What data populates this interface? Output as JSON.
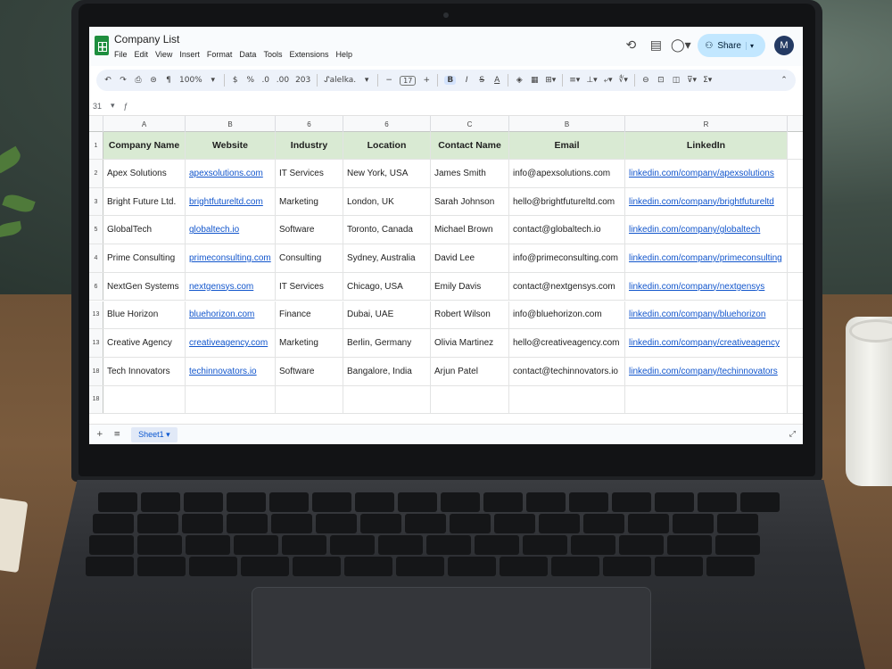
{
  "app": {
    "title": "Company List",
    "menu": [
      "File",
      "Edit",
      "View",
      "Insert",
      "Format",
      "Data",
      "Tools",
      "Extensions",
      "Help"
    ],
    "share_label": "Share",
    "avatar_initial": "M"
  },
  "toolbar": {
    "zoom": "100%",
    "currency": "$",
    "percent": "%",
    "decimals_dec": ".0",
    "decimals_inc": ".00",
    "format_123": "203",
    "font": "ᔑalelka.",
    "font_size": "17",
    "bold": "B",
    "italic": "I",
    "strike": "S",
    "text_color": "A"
  },
  "formula_bar": {
    "cell_ref": "31",
    "fx": "ƒ"
  },
  "columns": [
    "A",
    "B",
    "6",
    "6",
    "C",
    "B",
    "R"
  ],
  "header_row_number": "1",
  "headers": [
    "Company Name",
    "Website",
    "Industry",
    "Location",
    "Contact Name",
    "Email",
    "LinkedIn"
  ],
  "rows": [
    {
      "num": "2",
      "company": "Apex Solutions",
      "website": "apexsolutions.com",
      "industry": "IT Services",
      "location": "New York, USA",
      "contact": "James Smith",
      "email": "info@apexsolutions.com",
      "linkedin": "linkedin.com/company/apexsolutions"
    },
    {
      "num": "3",
      "company": "Bright Future Ltd.",
      "website": "brightfutureltd.com",
      "industry": "Marketing",
      "location": "London, UK",
      "contact": "Sarah Johnson",
      "email": "hello@brightfutureltd.com",
      "linkedin": "linkedin.com/company/brightfutureltd"
    },
    {
      "num": "5",
      "company": "GlobalTech",
      "website": "globaltech.io",
      "industry": "Software",
      "location": "Toronto, Canada",
      "contact": "Michael Brown",
      "email": "contact@globaltech.io",
      "linkedin": "linkedin.com/company/globaltech"
    },
    {
      "num": "4",
      "company": "Prime Consulting",
      "website": "primeconsulting.com",
      "industry": "Consulting",
      "location": "Sydney, Australia",
      "contact": "David Lee",
      "email": "info@primeconsulting.com",
      "linkedin": "linkedin.com/company/primeconsulting"
    },
    {
      "num": "6",
      "company": "NextGen Systems",
      "website": "nextgensys.com",
      "industry": "IT Services",
      "location": "Chicago, USA",
      "contact": "Emily Davis",
      "email": "contact@nextgensys.com",
      "linkedin": "linkedin.com/company/nextgensys"
    },
    {
      "num": "13",
      "company": "Blue Horizon",
      "website": "bluehorizon.com",
      "industry": "Finance",
      "location": "Dubai, UAE",
      "contact": "Robert Wilson",
      "email": "info@bluehorizon.com",
      "linkedin": "linkedin.com/company/bluehorizon"
    },
    {
      "num": "13",
      "company": "Creative Agency",
      "website": "creativeagency.com",
      "industry": "Marketing",
      "location": "Berlin, Germany",
      "contact": "Olivia Martinez",
      "email": "hello@creativeagency.com",
      "linkedin": "linkedin.com/company/creativeagency"
    },
    {
      "num": "18",
      "company": "Tech Innovators",
      "website": "techinnovators.io",
      "industry": "Software",
      "location": "Bangalore, India",
      "contact": "Arjun Patel",
      "email": "contact@techinnovators.io",
      "linkedin": "linkedin.com/company/techinnovators"
    },
    {
      "num": "18",
      "company": "",
      "website": "",
      "industry": "",
      "location": "",
      "contact": "",
      "email": "",
      "linkedin": ""
    }
  ],
  "sheet_tab": "Sheet1",
  "icons": {
    "history": "history-icon",
    "comment": "comment-icon",
    "meet": "meet-icon",
    "undo": "undo-icon",
    "redo": "redo-icon",
    "print": "print-icon",
    "paint_format": "paint-format-icon"
  }
}
